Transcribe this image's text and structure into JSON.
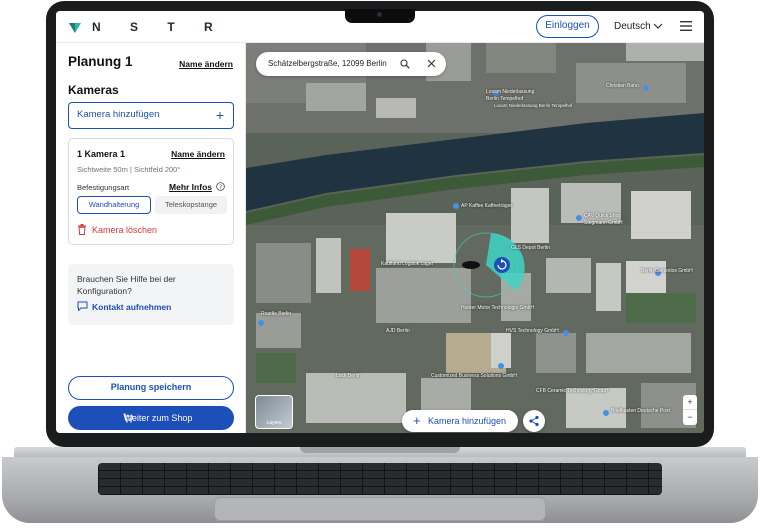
{
  "header": {
    "logo_text": "N S T R",
    "login_label": "Einloggen",
    "language": "Deutsch"
  },
  "sidebar": {
    "plan_title": "Planung 1",
    "rename_label": "Name ändern",
    "cameras_title": "Kameras",
    "add_camera_label": "Kamera hinzufügen",
    "camera": {
      "name": "1  Kamera 1",
      "rename_label": "Name ändern",
      "specs": "Sichtweite 50m  |  Sichtfeld 200°",
      "mount_label": "Befestigungsart",
      "more_info_label": "Mehr Infos",
      "option_wall": "Wandhalterung",
      "option_pole": "Teleskopstange",
      "delete_label": "Kamera löschen"
    },
    "help": {
      "text": "Brauchen Sie Hilfe bei der Konfiguration?",
      "contact_label": "Kontakt aufnehmen"
    },
    "save_label": "Planung speichern",
    "shop_label": "Weiter zum Shop"
  },
  "map": {
    "search_value": "Schätzelbergstraße, 12099 Berlin",
    "layers_label": "Layers",
    "add_camera_label": "Kamera hinzufügen",
    "zoom_in": "+",
    "zoom_out": "−",
    "labels": {
      "l1": "Loxam Niederlassung",
      "l2": "Berlin Tempelhof",
      "l3": "Loxam Niederlassung Berlin Tempelhof",
      "l4": "Christian Bahn",
      "l5": "AP Kaffee Kaffeeträger",
      "l6": "GLS Depot Berlin",
      "l7": "Kaufland Logistik Lager",
      "l8": "CAV Quick Shop",
      "l9": "Stegmann GmbH",
      "l10": "Hunter Motor Technologie GmbH",
      "l11": "HVS Technology GmbH",
      "l12": "Lock Berlin",
      "l13": "Customized Business Solutions GmbH",
      "l14": "CFB Ceramic Technology GmbH",
      "l15": "Briefkasten Deutsche Post",
      "l16": "AJD Berlin",
      "l17": "Roadie Berlin",
      "l18": "Berlin Gartenlos GmbH"
    }
  },
  "colors": {
    "brand_blue": "#1d4fb8",
    "danger_red": "#d23a3a",
    "fov_teal": "#3fd3c3"
  }
}
